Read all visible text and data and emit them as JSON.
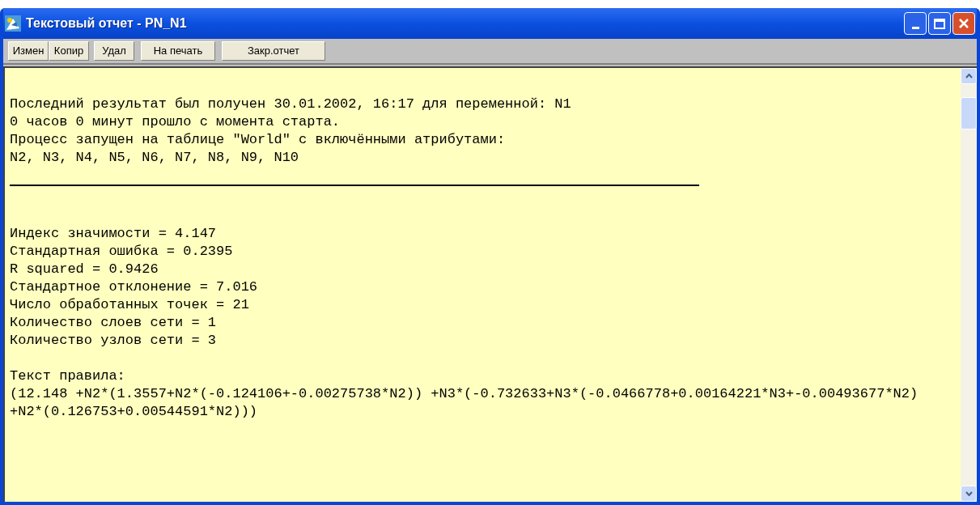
{
  "window": {
    "title": "Текстовый отчет - PN_N1"
  },
  "toolbar": [
    "Измен",
    "Копир",
    "Удал",
    "На печать",
    "Закр.отчет"
  ],
  "report": [
    {
      "kind": "lines",
      "lines": [
        "Последний результат был получен 30.01.2002, 16:17 для переменной: N1",
        "0 часов 0 минут прошло с момента старта.",
        "Процесс запущен на таблице \"World\" с включёнными атрибутами:",
        "N2, N3, N4, N5, N6, N7, N8, N9, N10"
      ]
    },
    {
      "kind": "rule"
    },
    {
      "kind": "lines",
      "lines": [
        "Индекс значимости = 4.147",
        "Стандартная ошибка = 0.2395",
        "R squared = 0.9426",
        "Стандартное отклонение = 7.016",
        "Число обработанных точек = 21",
        "Количество слоев сети = 1",
        "Количество узлов сети = 3"
      ]
    },
    {
      "kind": "lines",
      "lines": [
        "Текст правила:",
        "(12.148 +N2*(1.3557+N2*(-0.124106+-0.00275738*N2)) +N3*(-0.732633+N3*(-0.0466778+0.00164221*N3+-0.00493677*N2)",
        "+N2*(0.126753+0.00544591*N2)))"
      ]
    }
  ]
}
